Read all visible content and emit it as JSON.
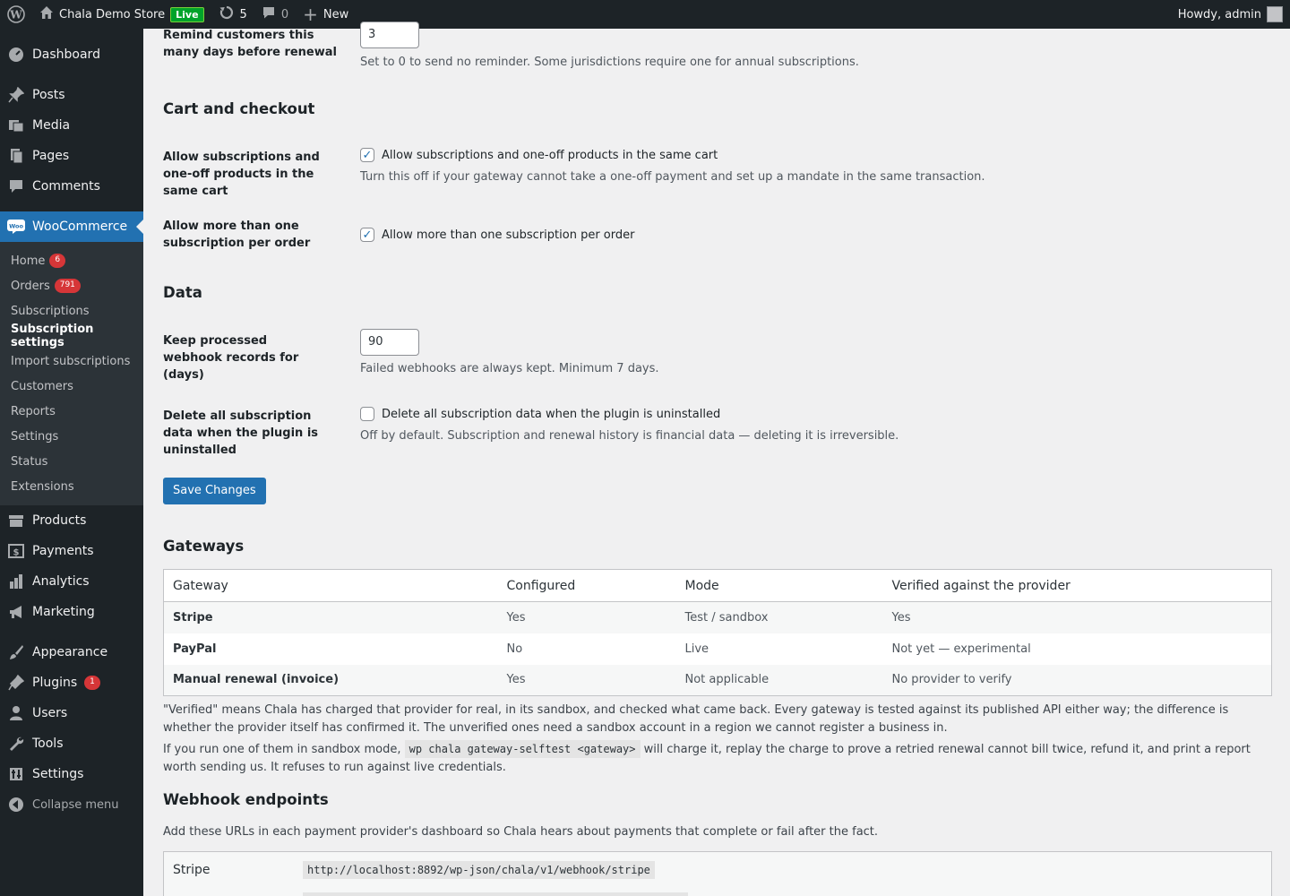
{
  "adminbar": {
    "site_name": "Chala Demo Store",
    "live_badge": "Live",
    "updates_count": "5",
    "comments_count": "0",
    "new_label": "New",
    "greeting": "Howdy, admin"
  },
  "sidebar": {
    "dashboard": "Dashboard",
    "posts": "Posts",
    "media": "Media",
    "pages": "Pages",
    "comments": "Comments",
    "woocommerce": "WooCommerce",
    "sub": {
      "home": "Home",
      "home_badge": "6",
      "orders": "Orders",
      "orders_badge": "791",
      "subscriptions": "Subscriptions",
      "subscription_settings": "Subscription settings",
      "import_subscriptions": "Import subscriptions",
      "customers": "Customers",
      "reports": "Reports",
      "settings": "Settings",
      "status": "Status",
      "extensions": "Extensions"
    },
    "products": "Products",
    "payments": "Payments",
    "analytics": "Analytics",
    "marketing": "Marketing",
    "appearance": "Appearance",
    "plugins": "Plugins",
    "plugins_badge": "1",
    "users": "Users",
    "tools": "Tools",
    "settings": "Settings",
    "collapse": "Collapse menu"
  },
  "reminder": {
    "label": "Remind customers this many days before renewal",
    "value": "3",
    "description": "Set to 0 to send no reminder. Some jurisdictions require one for annual subscriptions."
  },
  "cart_section": {
    "heading": "Cart and checkout",
    "mixed_label": "Allow subscriptions and one-off products in the same cart",
    "mixed_checkbox": "Allow subscriptions and one-off products in the same cart",
    "mixed_checked": true,
    "mixed_description": "Turn this off if your gateway cannot take a one-off payment and set up a mandate in the same transaction.",
    "multi_label": "Allow more than one subscription per order",
    "multi_checkbox": "Allow more than one subscription per order",
    "multi_checked": true
  },
  "data_section": {
    "heading": "Data",
    "webhook_label": "Keep processed webhook records for (days)",
    "webhook_value": "90",
    "webhook_description": "Failed webhooks are always kept. Minimum 7 days.",
    "delete_label": "Delete all subscription data when the plugin is uninstalled",
    "delete_checkbox": "Delete all subscription data when the plugin is uninstalled",
    "delete_checked": false,
    "delete_description": "Off by default. Subscription and renewal history is financial data — deleting it is irreversible."
  },
  "save_button": "Save Changes",
  "gateways": {
    "heading": "Gateways",
    "columns": [
      "Gateway",
      "Configured",
      "Mode",
      "Verified against the provider"
    ],
    "rows": [
      [
        "Stripe",
        "Yes",
        "Test / sandbox",
        "Yes"
      ],
      [
        "PayPal",
        "No",
        "Live",
        "Not yet — experimental"
      ],
      [
        "Manual renewal (invoice)",
        "Yes",
        "Not applicable",
        "No provider to verify"
      ]
    ],
    "note1": "\"Verified\" means Chala has charged that provider for real, in its sandbox, and checked what came back. Every gateway is tested against its published API either way; the difference is whether the provider itself has confirmed it. The unverified ones need a sandbox account in a region we cannot register a business in.",
    "note2_before": "If you run one of them in sandbox mode, ",
    "note2_code": "wp chala gateway-selftest <gateway>",
    "note2_after": " will charge it, replay the charge to prove a retried renewal cannot bill twice, refund it, and print a report worth sending us. It refuses to run against live credentials."
  },
  "webhooks": {
    "heading": "Webhook endpoints",
    "description": "Add these URLs in each payment provider's dashboard so Chala hears about payments that complete or fail after the fact.",
    "rows": [
      {
        "name": "Stripe",
        "url": "http://localhost:8892/wp-json/chala/v1/webhook/stripe"
      }
    ]
  },
  "colors": {
    "admin_bg": "#1d2327",
    "accent": "#2271b1",
    "badge": "#d63638",
    "live": "#00a32a"
  }
}
